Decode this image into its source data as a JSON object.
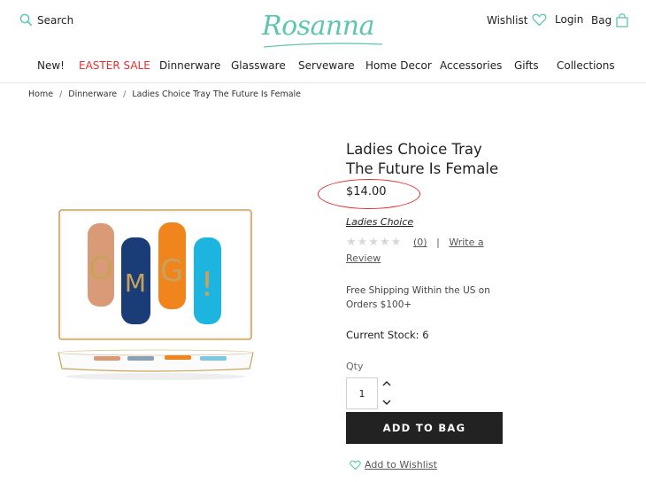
{
  "header": {
    "search_label": "Search",
    "logo_text": "Rosanna",
    "wishlist_label": "Wishlist",
    "login_label": "Login",
    "bag_label": "Bag"
  },
  "nav": {
    "items": [
      "New!",
      "EASTER SALE",
      "Dinnerware",
      "Glassware",
      "Serveware",
      "Home Decor",
      "Accessories",
      "Gifts",
      "Collections"
    ]
  },
  "breadcrumb": {
    "items": [
      "Home",
      "Dinnerware",
      "Ladies Choice Tray The Future Is Female"
    ]
  },
  "product": {
    "title_line1": "Ladies Choice Tray",
    "title_line2": "The Future Is Female",
    "price": "$14.00",
    "brand": "Ladies Choice",
    "review_count": "(0)",
    "review_sep": "|",
    "write_review_part1": "Write a",
    "write_review_part2": "Review",
    "rating": 0,
    "shipping_line1": "Free Shipping Within the US on",
    "shipping_line2": "Orders $100+",
    "stock_text": "Current Stock: 6",
    "qty_label": "Qty",
    "qty_value": "1",
    "add_to_bag_label": "ADD TO BAG",
    "add_to_wishlist_label": "Add to Wishlist",
    "tray_letters": [
      "O",
      "M",
      "G",
      "!"
    ]
  },
  "colors": {
    "logo": "#5cc6b0",
    "accent_teal": "#5cc6b0",
    "sale_red": "#e0312f",
    "annotation_circle": "#e0312f",
    "button_bg": "#222222",
    "stripe_peach": "#d99a78",
    "stripe_navy": "#1a3d78",
    "stripe_orange": "#f0851e",
    "stripe_cyan": "#1eb4e0",
    "tray_gold": "#c9a25a"
  }
}
